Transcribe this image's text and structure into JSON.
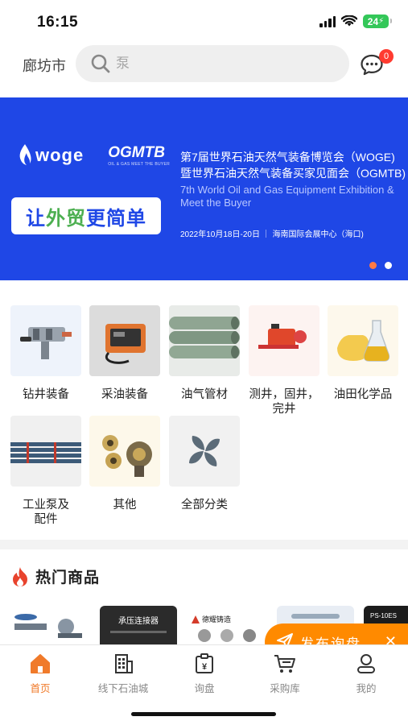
{
  "status": {
    "time": "16:15",
    "battery": "24"
  },
  "header": {
    "city": "廊坊市",
    "search_placeholder": "泵",
    "message_badge": "0"
  },
  "banner": {
    "woge_logo": "woge",
    "ogmtb_logo": "OGMTB",
    "ogmtb_sub": "OIL & GAS MEET THE BUYER",
    "slogan_1": "让",
    "slogan_2": "外贸",
    "slogan_3": "更简单",
    "title_cn_1": "第7届世界石油天然气装备博览会（WOGE)",
    "title_cn_2": "暨世界石油天然气装备买家见面会（OGMTB)",
    "title_en": "7th World Oil and Gas Equipment Exhibition & Meet the Buyer",
    "date": "2022年10月18日-20日 ｜ 海南国际会展中心（海口)"
  },
  "categories": [
    {
      "label": "钻井装备",
      "icon": "drilling-equipment"
    },
    {
      "label": "采油装备",
      "icon": "oil-extraction-equipment"
    },
    {
      "label": "油气管材",
      "icon": "pipes"
    },
    {
      "label": "测井，固井，完井",
      "icon": "logging-equipment"
    },
    {
      "label": "油田化学品",
      "icon": "chemicals"
    },
    {
      "label": "工业泵及配件",
      "icon": "pump-pipes"
    },
    {
      "label": "其他",
      "icon": "drill-bits"
    },
    {
      "label": "全部分类",
      "icon": "all-categories"
    }
  ],
  "hot": {
    "title": "热门商品"
  },
  "products": [
    {
      "name": "product-1"
    },
    {
      "name": "product-2",
      "text": "承压连接器"
    },
    {
      "name": "product-3",
      "text": "德耀铸造"
    },
    {
      "name": "product-4"
    },
    {
      "name": "product-5",
      "text": "PS-10ES"
    }
  ],
  "publish": {
    "label": "发布询盘",
    "close": "✕"
  },
  "tabs": [
    {
      "label": "首页",
      "icon": "home-icon",
      "active": true
    },
    {
      "label": "线下石油城",
      "icon": "building-icon"
    },
    {
      "label": "询盘",
      "icon": "inquiry-icon"
    },
    {
      "label": "采购库",
      "icon": "cart-icon"
    },
    {
      "label": "我的",
      "icon": "user-icon"
    }
  ],
  "colors": {
    "accent": "#f07a2a",
    "banner": "#1f47e6",
    "publish": "#ff8a00",
    "badge": "#ff3b30"
  }
}
